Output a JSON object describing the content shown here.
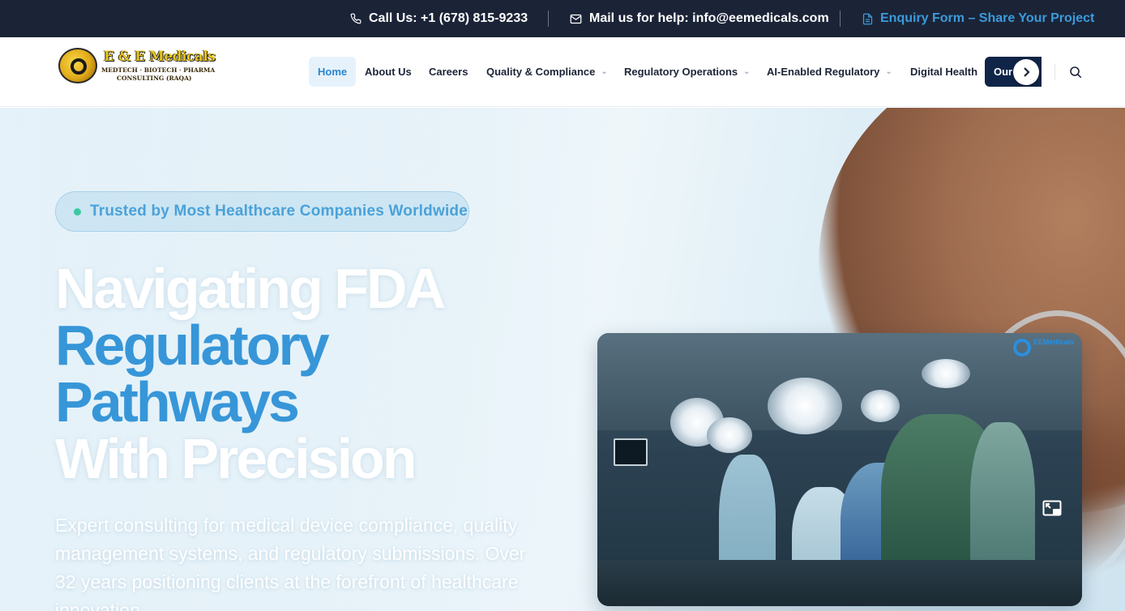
{
  "topbar": {
    "phone_label": "Call Us: +1 (678) 815-9233",
    "mail_label": "Mail us for help: info@eemedicals.com",
    "enquiry_label": "Enquiry Form – Share Your Project",
    "icons": {
      "phone": "phone-icon",
      "mail": "mail-icon",
      "enquiry": "document-icon"
    },
    "colors": {
      "background": "#1b2437",
      "text": "#ffffff",
      "accent": "#3b9bdc"
    }
  },
  "logo": {
    "name": "E & E Medicals",
    "tagline_1": "MEDTECH · BIOTECH · PHARMA",
    "tagline_2": "CONSULTING (RAQA)"
  },
  "nav": {
    "items": [
      {
        "label": "Home",
        "active": true,
        "dropdown": false
      },
      {
        "label": "About Us",
        "active": false,
        "dropdown": false
      },
      {
        "label": "Careers",
        "active": false,
        "dropdown": false
      },
      {
        "label": "Quality & Compliance",
        "active": false,
        "dropdown": true
      },
      {
        "label": "Regulatory Operations",
        "active": false,
        "dropdown": true
      },
      {
        "label": "AI-Enabled Regulatory",
        "active": false,
        "dropdown": true
      },
      {
        "label": "Digital Health",
        "active": false,
        "dropdown": false
      }
    ],
    "cta_label": "Our",
    "chevron_glyph": "⌄",
    "next_icon": "chevron-right-icon",
    "search_icon": "search-icon",
    "colors": {
      "active_bg": "#e6f2fb",
      "active_text": "#2a86cf",
      "text": "#1b2437",
      "cta_bg": "#0f2447"
    }
  },
  "hero": {
    "badge_text": "Trusted by Most Healthcare Companies Worldwide",
    "headline_line1": "Navigating FDA",
    "headline_line2": "Regulatory",
    "headline_line3": "Pathways",
    "headline_line4": "With Precision",
    "description": "Expert consulting for medical device compliance, quality management systems, and regulatory submissions. Over 32 years positioning clients at the forefront of healthcare innovation.",
    "colors": {
      "accent": "#3796d8",
      "badge_dot": "#3cc9a0",
      "badge_text": "#4aa2d9"
    }
  },
  "video": {
    "description_icon": "operating-room-video",
    "watermark_text": "EEMedicals",
    "pip_icon": "picture-in-picture-icon"
  }
}
